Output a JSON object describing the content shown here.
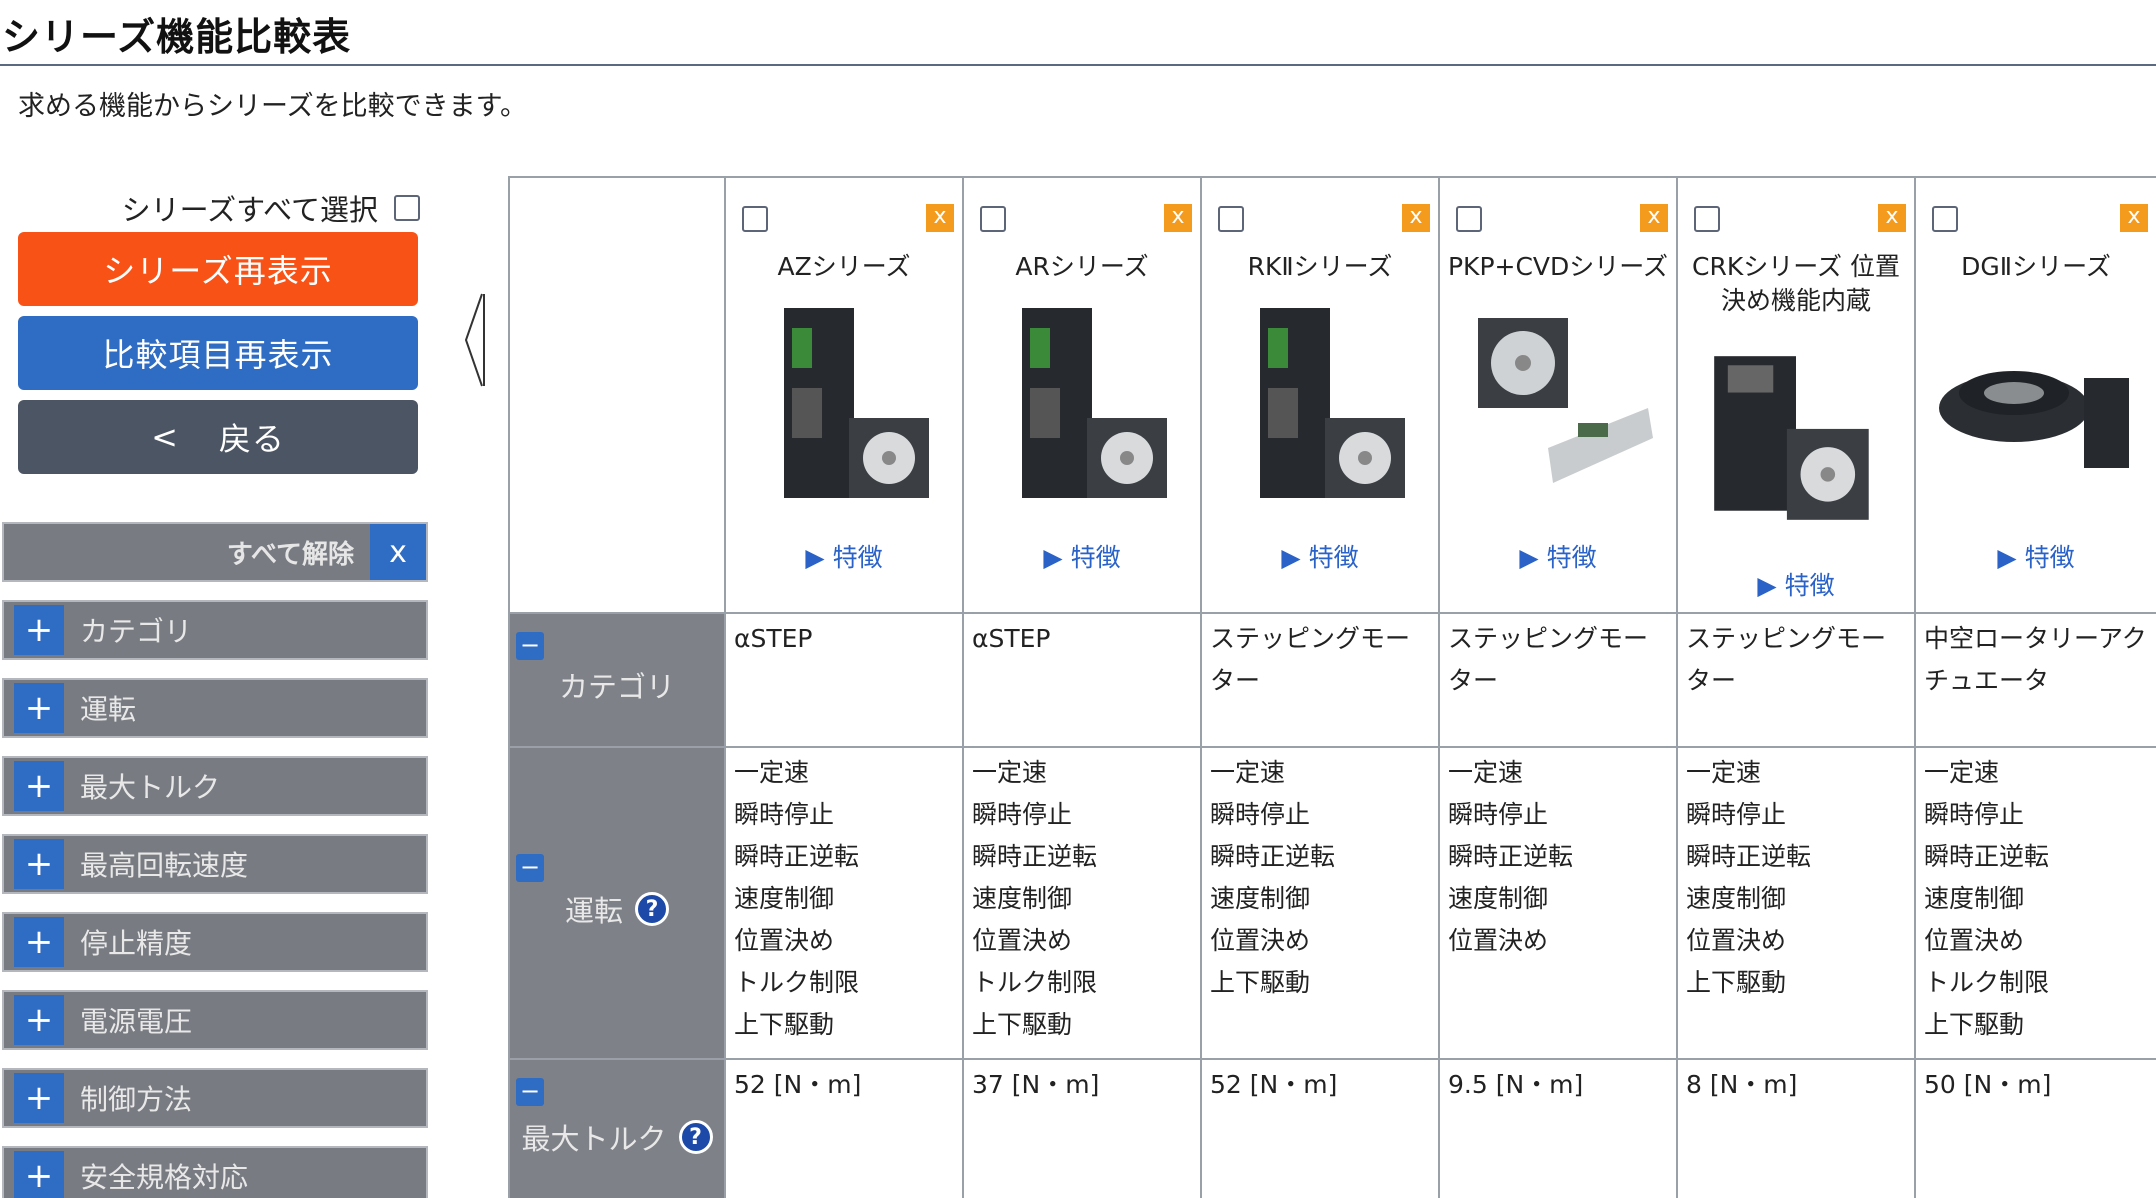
{
  "title": "シリーズ機能比較表",
  "intro": "求める機能からシリーズを比較できます。",
  "left_panel": {
    "select_all_label": "シリーズすべて選択",
    "redisplay_button": "シリーズ再表示",
    "items_button": "比較項目再表示",
    "back_arrow": "<",
    "back_button": "戻る",
    "clear_all_label": "すべて解除",
    "clear_all_x": "x",
    "plus_symbol": "+",
    "filters": [
      "カテゴリ",
      "運転",
      "最大トルク",
      "最高回転速度",
      "停止精度",
      "電源電圧",
      "制御方法",
      "安全規格対応"
    ]
  },
  "table": {
    "remove_x": "x",
    "feature_link": "▶ 特徴",
    "minus_symbol": "−",
    "help_symbol": "?",
    "row_labels": {
      "category": "カテゴリ",
      "operation": "運転",
      "max_torque": "最大トルク"
    },
    "products": [
      {
        "name": "AZシリーズ",
        "category": "αSTEP",
        "operations": [
          "一定速",
          "瞬時停止",
          "瞬時正逆転",
          "速度制御",
          "位置決め",
          "トルク制限",
          "上下駆動"
        ],
        "max_torque": "52 [N・m]"
      },
      {
        "name": "ARシリーズ",
        "category": "αSTEP",
        "operations": [
          "一定速",
          "瞬時停止",
          "瞬時正逆転",
          "速度制御",
          "位置決め",
          "トルク制限",
          "上下駆動"
        ],
        "max_torque": "37 [N・m]"
      },
      {
        "name": "RKⅡシリーズ",
        "category": "ステッピングモーター",
        "operations": [
          "一定速",
          "瞬時停止",
          "瞬時正逆転",
          "速度制御",
          "位置決め",
          "上下駆動"
        ],
        "max_torque": "52 [N・m]"
      },
      {
        "name": "PKP+CVDシリーズ",
        "category": "ステッピングモーター",
        "operations": [
          "一定速",
          "瞬時停止",
          "瞬時正逆転",
          "速度制御",
          "位置決め"
        ],
        "max_torque": "9.5 [N・m]"
      },
      {
        "name": "CRKシリーズ 位置決め機能内蔵",
        "category": "ステッピングモーター",
        "operations": [
          "一定速",
          "瞬時停止",
          "瞬時正逆転",
          "速度制御",
          "位置決め",
          "上下駆動"
        ],
        "max_torque": "8 [N・m]"
      },
      {
        "name": "DGⅡシリーズ",
        "category": "中空ロータリーアクチュエータ",
        "operations": [
          "一定速",
          "瞬時停止",
          "瞬時正逆転",
          "速度制御",
          "位置決め",
          "トルク制限",
          "上下駆動"
        ],
        "max_torque": "50 [N・m]"
      }
    ]
  }
}
